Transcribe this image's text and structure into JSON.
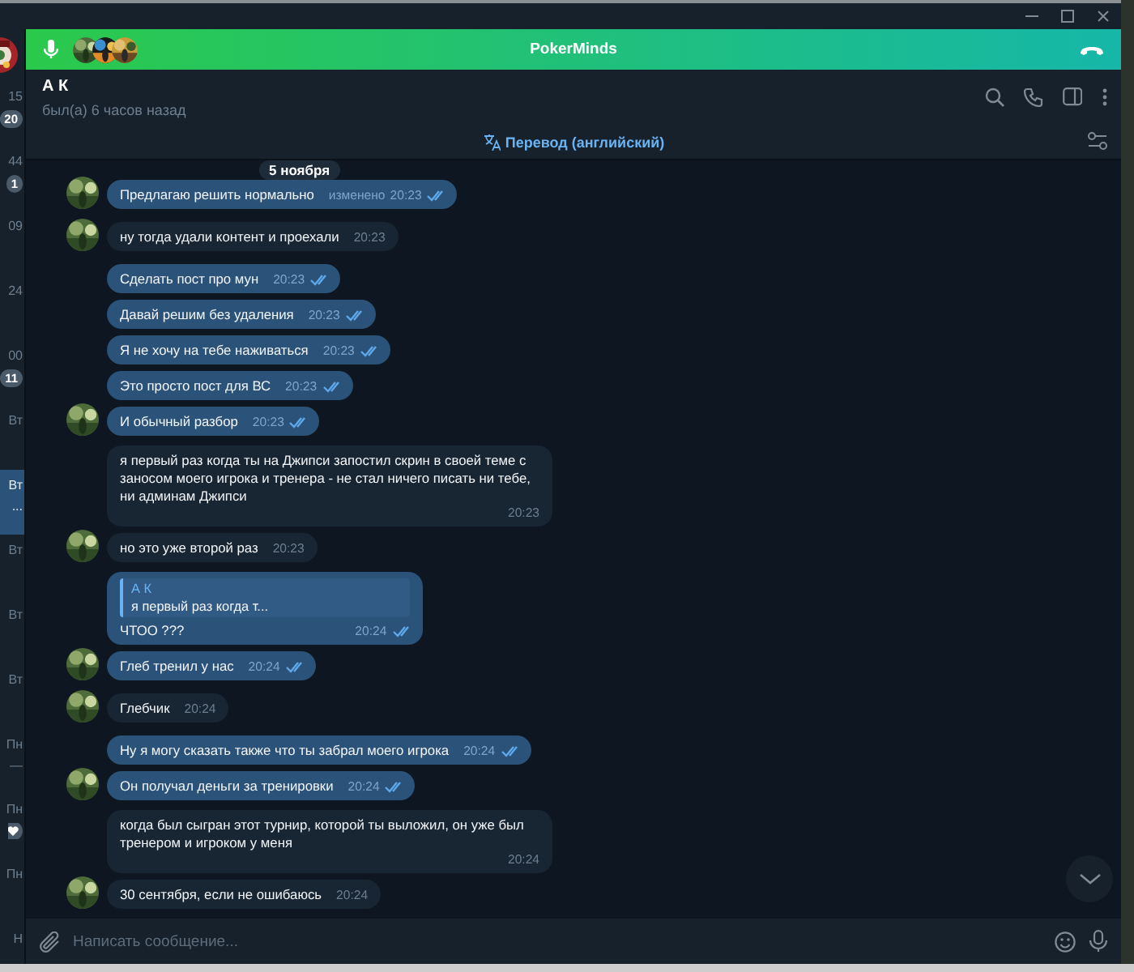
{
  "call_bar": {
    "title": "PokerMinds"
  },
  "chat_list": [
    {
      "kind": "badge",
      "time": "15",
      "extra": "20",
      "selected": false
    },
    {
      "kind": "badge",
      "time": "44",
      "extra": "1",
      "selected": false
    },
    {
      "kind": "plain",
      "time": "09",
      "selected": false
    },
    {
      "kind": "plain",
      "time": "24",
      "selected": false
    },
    {
      "kind": "badge",
      "time": "00",
      "extra": "11",
      "selected": false
    },
    {
      "kind": "plain",
      "time": "Вт",
      "selected": false
    },
    {
      "kind": "sub",
      "time": "Вт",
      "extra": "...",
      "selected": true
    },
    {
      "kind": "plain",
      "time": "Вт",
      "selected": false
    },
    {
      "kind": "plain",
      "time": "Вт",
      "selected": false
    },
    {
      "kind": "plain",
      "time": "Вт",
      "selected": false
    },
    {
      "kind": "sub",
      "time": "Пн",
      "extra": "—",
      "selected": false
    },
    {
      "kind": "heart",
      "time": "Пн",
      "selected": false
    },
    {
      "kind": "plain",
      "time": "Пн",
      "selected": false
    },
    {
      "kind": "plain",
      "time": "Н",
      "selected": false
    }
  ],
  "header": {
    "name": "А К",
    "status": "был(а) 6 часов назад"
  },
  "translate_bar": {
    "label": "Перевод (английский)"
  },
  "date_pill": "5 ноября",
  "messages": [
    {
      "kind": "text",
      "outgoing": true,
      "avatar": true,
      "text": "Предлагаю  решить нормально",
      "edited": "изменено",
      "time": "20:23"
    },
    {
      "kind": "text",
      "outgoing": false,
      "avatar": true,
      "text": "ну тогда удали контент и проехали",
      "time": "20:23"
    },
    {
      "kind": "text",
      "outgoing": true,
      "avatar": false,
      "text": "Сделать пост про мун",
      "time": "20:23"
    },
    {
      "kind": "text",
      "outgoing": true,
      "avatar": false,
      "text": "Давай решим без удаления",
      "time": "20:23"
    },
    {
      "kind": "text",
      "outgoing": true,
      "avatar": false,
      "text": "Я не хочу на тебе наживаться",
      "time": "20:23"
    },
    {
      "kind": "text",
      "outgoing": true,
      "avatar": false,
      "text": "Это просто пост для ВС",
      "time": "20:23"
    },
    {
      "kind": "text",
      "outgoing": true,
      "avatar": true,
      "text": "И обычный разбор",
      "time": "20:23"
    },
    {
      "kind": "text",
      "outgoing": false,
      "avatar": false,
      "text": "я первый раз когда ты на Джипси запостил скрин в своей теме с заносом моего игрока и тренера - не стал ничего писать ни тебе, ни админам Джипси",
      "time": "20:23"
    },
    {
      "kind": "text",
      "outgoing": false,
      "avatar": true,
      "text": "но это уже второй раз",
      "time": "20:23"
    },
    {
      "kind": "reply",
      "outgoing": true,
      "avatar": false,
      "quote": {
        "author": "А К",
        "text": "я первый раз когда т..."
      },
      "text": "ЧТОО ???",
      "time": "20:24"
    },
    {
      "kind": "text",
      "outgoing": true,
      "avatar": true,
      "text": "Глеб тренил у нас",
      "time": "20:24"
    },
    {
      "kind": "text",
      "outgoing": false,
      "avatar": true,
      "text": "Глебчик",
      "time": "20:24"
    },
    {
      "kind": "text",
      "outgoing": true,
      "avatar": false,
      "text": "Ну я могу сказать также что ты забрал моего игрока",
      "time": "20:24"
    },
    {
      "kind": "text",
      "outgoing": true,
      "avatar": true,
      "text": "Он получал деньги за тренировки",
      "time": "20:24"
    },
    {
      "kind": "text",
      "outgoing": false,
      "avatar": false,
      "text": "когда был сыгран этот турнир, которой ты выложил, он уже был тренером и игроком у меня",
      "time": "20:24"
    },
    {
      "kind": "text",
      "outgoing": false,
      "avatar": true,
      "text": "30 сентября, если не ошибаюсь",
      "time": "20:24"
    }
  ],
  "composer": {
    "placeholder": "Написать сообщение..."
  }
}
